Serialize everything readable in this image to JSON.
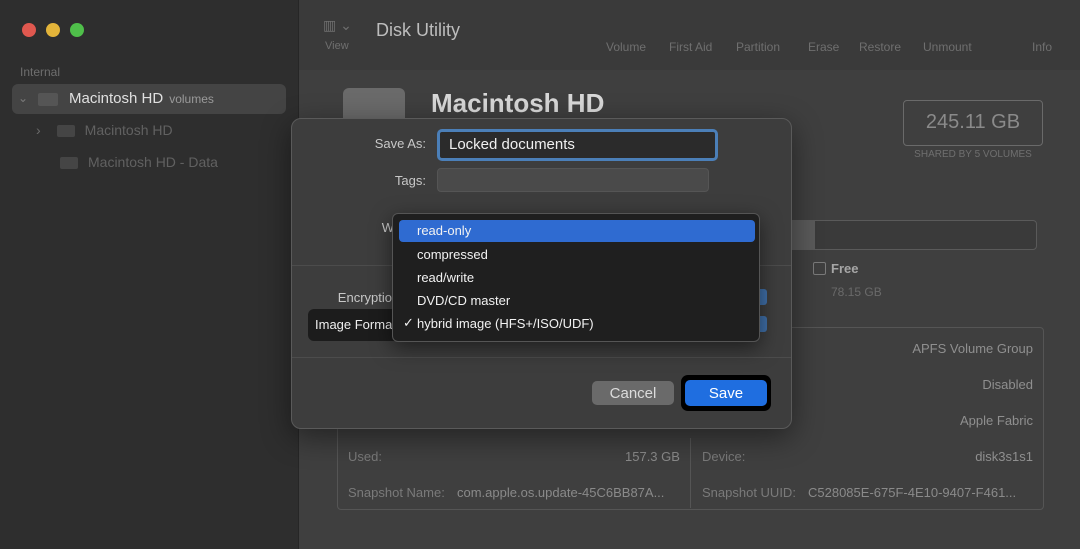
{
  "app": {
    "title": "Disk Utility"
  },
  "toolbar": {
    "view_label": "View",
    "buttons": [
      "Volume",
      "First Aid",
      "Partition",
      "Erase",
      "Restore",
      "Unmount",
      "Info"
    ]
  },
  "sidebar": {
    "section": "Internal",
    "items": [
      {
        "label": "Macintosh HD",
        "sub": "volumes"
      },
      {
        "label": "Macintosh HD"
      },
      {
        "label": "Macintosh HD - Data"
      }
    ]
  },
  "main": {
    "title": "Macintosh HD",
    "capacity": "245.11 GB",
    "capacity_sub": "SHARED BY 5 VOLUMES",
    "usage_fraction": 0.14,
    "free_label": "Free",
    "free_value": "78.15 GB",
    "info": {
      "type_value": "APFS Volume Group",
      "owners_value": "Disabled",
      "connection_value": "Apple Fabric",
      "used_label": "Used:",
      "used_value": "157.3 GB",
      "device_label": "Device:",
      "device_value": "disk3s1s1",
      "snapshot_name_label": "Snapshot Name:",
      "snapshot_name_value": "com.apple.os.update-45C6BB87A...",
      "snapshot_uuid_label": "Snapshot UUID:",
      "snapshot_uuid_value": "C528085E-675F-4E10-9407-F461..."
    }
  },
  "dialog": {
    "save_as_label": "Save As:",
    "save_as_value": "Locked documents",
    "tags_label": "Tags:",
    "where_label_partial": "W",
    "encryption_label_partial": "Encryptio",
    "image_format_label_partial": "Image Forma",
    "cancel": "Cancel",
    "save": "Save"
  },
  "menu": {
    "items": [
      {
        "label": "read-only",
        "highlighted": true,
        "checked": false
      },
      {
        "label": "compressed",
        "highlighted": false,
        "checked": false
      },
      {
        "label": "read/write",
        "highlighted": false,
        "checked": false
      },
      {
        "label": "DVD/CD master",
        "highlighted": false,
        "checked": false
      },
      {
        "label": "hybrid image (HFS+/ISO/UDF)",
        "highlighted": false,
        "checked": true
      }
    ],
    "check_glyph": "✓"
  },
  "colors": {
    "accent": "#1f6ee0",
    "menu_highlight": "#2f6bd1"
  }
}
